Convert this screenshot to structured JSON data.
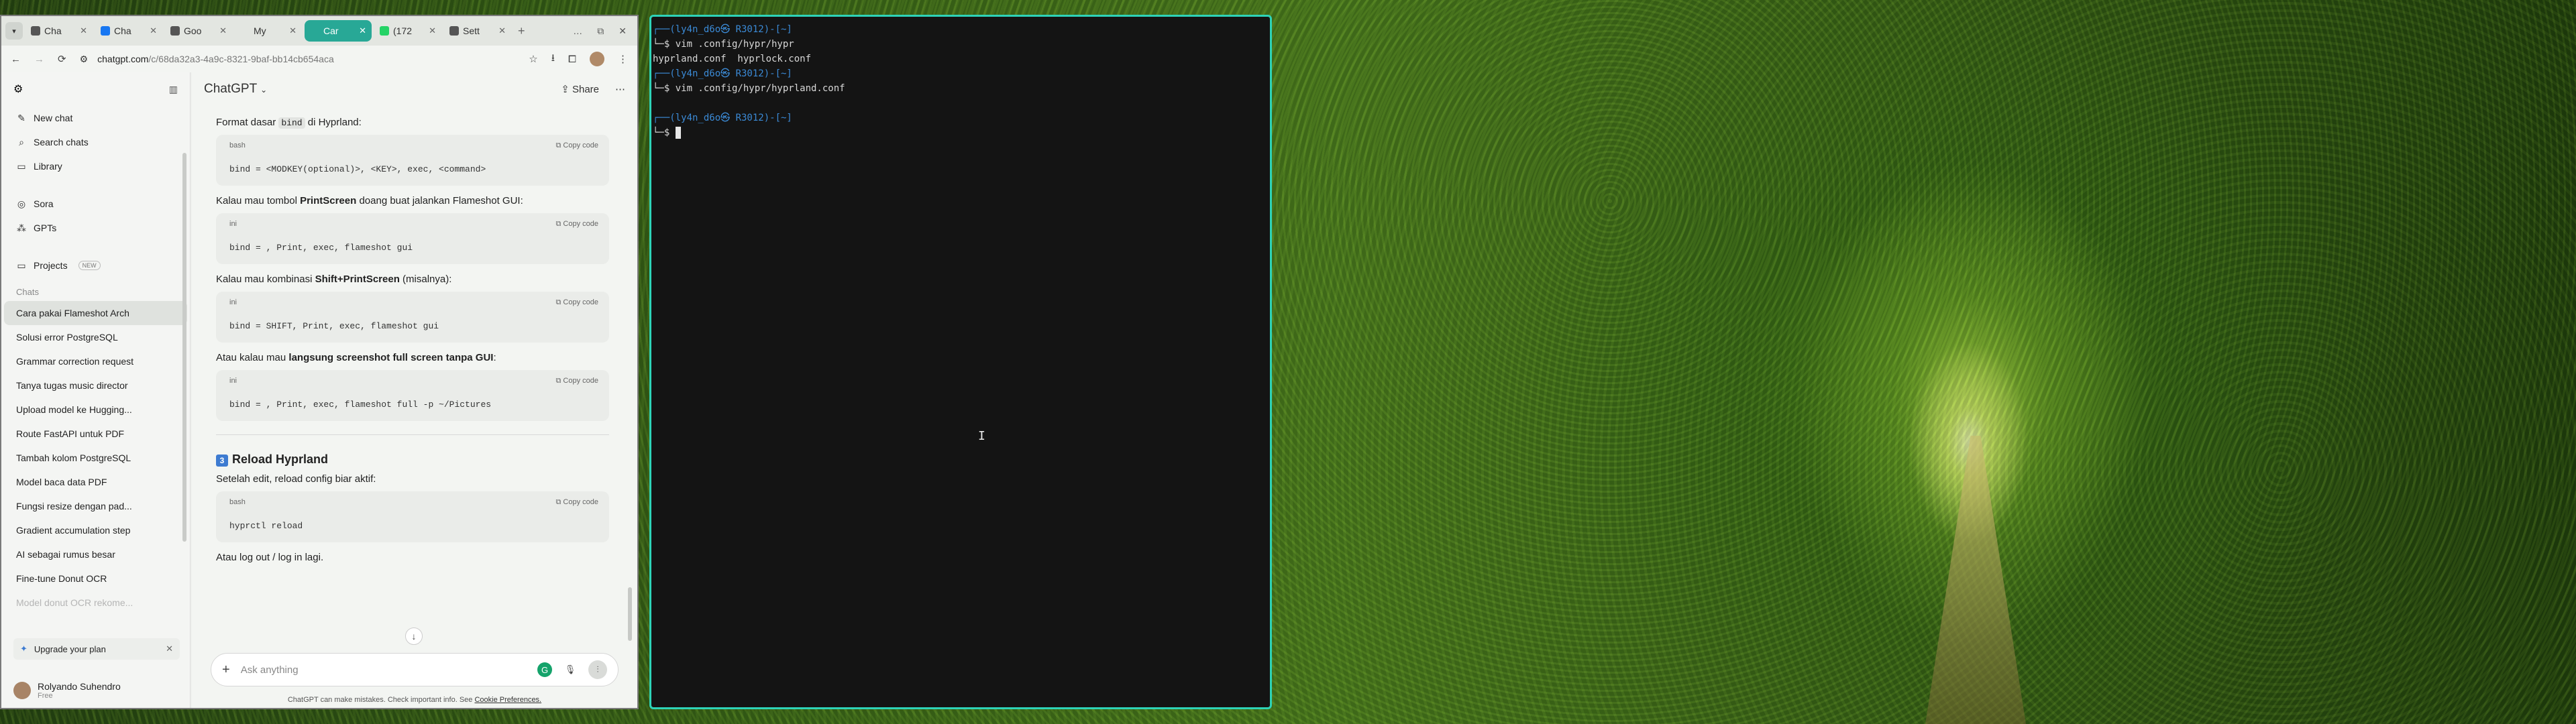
{
  "browser": {
    "tabs": [
      {
        "label": "Cha",
        "icon": "chatgpt-icon",
        "active": false
      },
      {
        "label": "Cha",
        "icon": "facebook-icon",
        "active": false
      },
      {
        "label": "Goo",
        "icon": "arrow-icon",
        "active": false
      },
      {
        "label": "My",
        "icon": "blank-icon",
        "active": false
      },
      {
        "label": "Car",
        "icon": "blank-icon",
        "active": true
      },
      {
        "label": "(172",
        "icon": "whatsapp-icon",
        "active": false
      },
      {
        "label": "Sett",
        "icon": "gear-icon",
        "active": false
      }
    ],
    "url_host": "chatgpt.com",
    "url_rest": "/c/68da32a3-4a9c-8321-9baf-bb14cb654aca"
  },
  "sidebar": {
    "new_chat": "New chat",
    "search_chats": "Search chats",
    "library": "Library",
    "sora": "Sora",
    "gpts": "GPTs",
    "projects": "Projects",
    "projects_badge": "NEW",
    "chats_header": "Chats",
    "chats": [
      "Cara pakai Flameshot Arch",
      "Solusi error PostgreSQL",
      "Grammar correction request",
      "Tanya tugas music director",
      "Upload model ke Hugging...",
      "Route FastAPI untuk PDF",
      "Tambah kolom PostgreSQL",
      "Model baca data PDF",
      "Fungsi resize dengan pad...",
      "Gradient accumulation step",
      "AI sebagai rumus besar",
      "Fine-tune Donut OCR",
      "Model donut OCR rekome..."
    ],
    "upgrade": "Upgrade your plan",
    "user_name": "Rolyando Suhendro",
    "user_plan": "Free"
  },
  "main": {
    "title": "ChatGPT",
    "share": "Share",
    "copy_label": "Copy code",
    "blocks": [
      {
        "pre": "Format dasar ",
        "inline": "bind",
        "post": " di Hyprland:",
        "lang": "bash",
        "code": "bind = <MODKEY(optional)>, <KEY>, exec, <command>"
      },
      {
        "pre": "Kalau mau tombol ",
        "bold": "PrintScreen",
        "post": " doang buat jalankan Flameshot GUI:",
        "lang": "ini",
        "code": "bind = , Print, exec, flameshot gui"
      },
      {
        "pre": "Kalau mau kombinasi ",
        "bold": "Shift+PrintScreen",
        "post": " (misalnya):",
        "lang": "ini",
        "code": "bind = SHIFT, Print, exec, flameshot gui"
      },
      {
        "pre": "Atau kalau mau ",
        "bold": "langsung screenshot full screen tanpa GUI",
        "post": ":",
        "lang": "ini",
        "code": "bind = , Print, exec, flameshot full -p ~/Pictures"
      }
    ],
    "section_num": "3",
    "section_title": "Reload Hyprland",
    "section_text": "Setelah edit, reload config biar aktif:",
    "section_lang": "bash",
    "section_code": "hyprctl reload",
    "tail_text": "Atau log out / log in lagi.",
    "composer_placeholder": "Ask anything",
    "disclaimer": "ChatGPT can make mistakes. Check important info. See",
    "disclaimer_link": "Cookie Preferences."
  },
  "terminal": {
    "lines": [
      {
        "type": "prompt",
        "text": "┌──(ly4n_d6o㉿ R3012)-[~]"
      },
      {
        "type": "cmd",
        "text": "└─$ vim .config/hypr/hypr"
      },
      {
        "type": "out",
        "text": "hyprland.conf  hyprlock.conf"
      },
      {
        "type": "prompt",
        "text": "┌──(ly4n_d6o㉿ R3012)-[~]"
      },
      {
        "type": "cmd",
        "text": "└─$ vim .config/hypr/hyprland.conf"
      },
      {
        "type": "blank",
        "text": ""
      },
      {
        "type": "prompt",
        "text": "┌──(ly4n_d6o㉿ R3012)-[~]"
      },
      {
        "type": "cmd",
        "text": "└─$ "
      }
    ]
  },
  "colors": {
    "accent": "#2ed3b7",
    "tab_active": "#28a896",
    "prompt": "#3b8ad6"
  }
}
